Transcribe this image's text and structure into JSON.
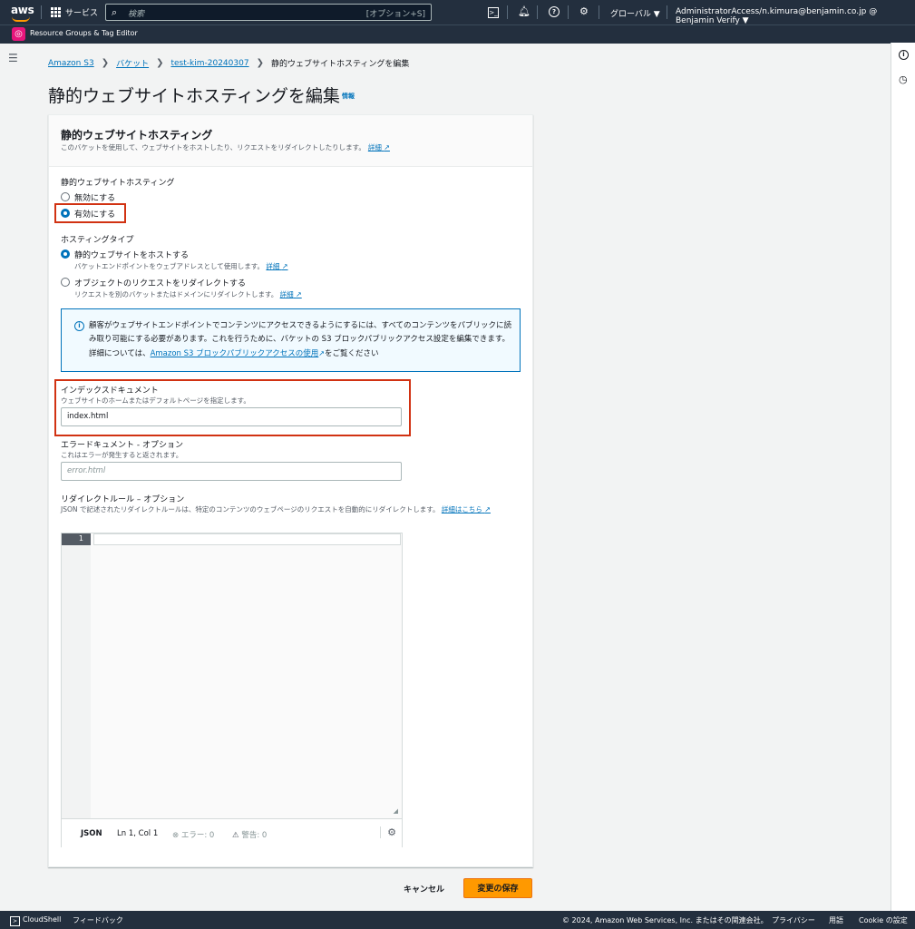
{
  "topbar": {
    "logo": "aws",
    "services": "サービス",
    "search_placeholder": "検索",
    "search_shortcut": "[オプション+S]",
    "cloudshell_icon": "terminal-icon",
    "notifications_icon": "bell-icon",
    "help_icon": "help-icon",
    "settings_icon": "gear-icon",
    "region": "グローバル ▼",
    "account": "AdministratorAccess/n.kimura@benjamin.co.jp @ Benjamin Verify ▼"
  },
  "subbar": {
    "service_label": "Resource Groups & Tag Editor"
  },
  "breadcrumb": {
    "items": [
      "Amazon S3",
      "バケット",
      "test-kim-20240307"
    ],
    "current": "静的ウェブサイトホスティングを編集"
  },
  "page": {
    "title": "静的ウェブサイトホスティングを編集",
    "info": "情報"
  },
  "panel": {
    "title": "静的ウェブサイトホスティング",
    "description": "このバケットを使用して、ウェブサイトをホストしたり、リクエストをリダイレクトしたりします。",
    "detail_link": "詳細",
    "hosting_label": "静的ウェブサイトホスティング",
    "disable": "無効にする",
    "enable": "有効にする",
    "hosting_enabled": true,
    "type_label": "ホスティングタイプ",
    "type_host": "静的ウェブサイトをホストする",
    "type_host_desc": "バケットエンドポイントをウェブアドレスとして使用します。",
    "type_redirect": "オブジェクトのリクエストをリダイレクトする",
    "type_redirect_desc": "リクエストを別のバケットまたはドメインにリダイレクトします。",
    "type_selected": "host",
    "alert_text_1": "顧客がウェブサイトエンドポイントでコンテンツにアクセスできるようにするには、すべてのコンテンツをパブリックに読み取り可能にする必要があります。これを行うために、バケットの S3 ブロックパブリックアクセス設定を編集できます。詳細については、",
    "alert_link": "Amazon S3 ブロックパブリックアクセスの使用",
    "alert_text_2": "をご覧ください",
    "index_label": "インデックスドキュメント",
    "index_desc": "ウェブサイトのホームまたはデフォルトページを指定します。",
    "index_value": "index.html",
    "error_label": "エラードキュメント - オプション",
    "error_desc": "これはエラーが発生すると返されます。",
    "error_placeholder": "error.html",
    "redirect_label": "リダイレクトルール – オプション",
    "redirect_desc": "JSON で記述されたリダイレクトルールは、特定のコンテンツのウェブページのリクエストを自動的にリダイレクトします。",
    "redirect_link": "詳細はこちら"
  },
  "editor": {
    "line_number": "1",
    "mode": "JSON",
    "cursor": "Ln 1, Col 1",
    "errors": "エラー: 0",
    "warnings": "警告: 0"
  },
  "actions": {
    "cancel": "キャンセル",
    "save": "変更の保存"
  },
  "footer": {
    "cloudshell": "CloudShell",
    "feedback": "フィードバック",
    "copyright": "© 2024, Amazon Web Services, Inc. またはその関連会社。",
    "privacy": "プライバシー",
    "terms": "用語",
    "cookie": "Cookie の設定"
  },
  "colors": {
    "accent": "#0073bb",
    "primary_button": "#ff9900",
    "highlight": "#d13212",
    "header": "#232f3e"
  }
}
